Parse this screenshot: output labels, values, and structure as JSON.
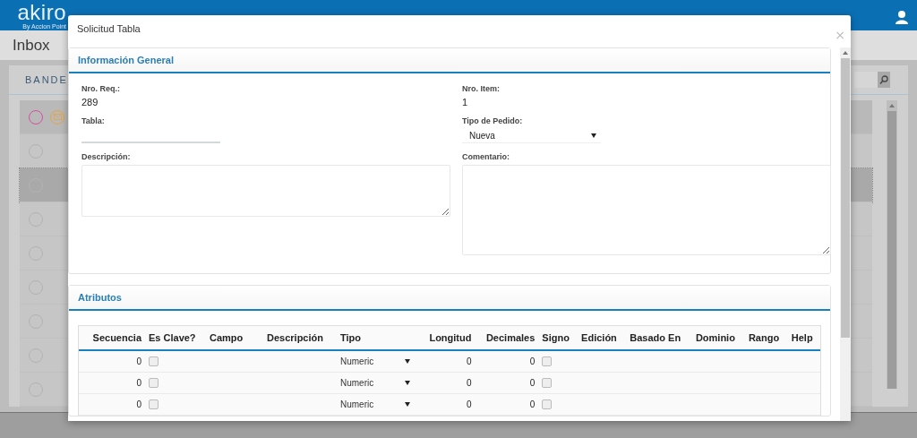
{
  "app_bar": {
    "logo": "akiro",
    "logo_tagline": "By Accion Point"
  },
  "page": {
    "title": "Inbox",
    "panel_title": "BANDE",
    "inbox_rows": [
      {
        "selected": false
      },
      {
        "selected": true
      },
      {
        "selected": false
      },
      {
        "selected": false
      },
      {
        "selected": false
      },
      {
        "selected": false
      },
      {
        "selected": false
      },
      {
        "selected": false
      }
    ]
  },
  "dialog": {
    "title": "Solicitud Tabla",
    "close": "×",
    "general": {
      "title": "Información General",
      "fields": [
        {
          "kind": "text",
          "label": "Nro. Req.:",
          "value": "289"
        },
        {
          "kind": "text",
          "label": "Nro. Item:",
          "value": "1"
        },
        {
          "kind": "input",
          "label": "Tabla:"
        },
        {
          "kind": "select",
          "label": "Tipo de Pedido:",
          "value": "Nueva"
        },
        {
          "kind": "textarea",
          "label": "Descripción:"
        },
        {
          "kind": "textarea",
          "label": "Comentario:"
        }
      ]
    },
    "attributes": {
      "title": "Atributos",
      "columns": [
        "Secuencia",
        "Es Clave?",
        "Campo",
        "Descripción",
        "Tipo",
        "Longitud",
        "Decimales",
        "Signo",
        "Edición",
        "Basado En",
        "Dominio",
        "Rango",
        "Help"
      ],
      "rows": [
        {
          "secuencia": "0",
          "es_clave": false,
          "tipo": "Numeric",
          "longitud": "0",
          "decimales": "0",
          "signo": false
        },
        {
          "secuencia": "0",
          "es_clave": false,
          "tipo": "Numeric",
          "longitud": "0",
          "decimales": "0",
          "signo": false
        },
        {
          "secuencia": "0",
          "es_clave": false,
          "tipo": "Numeric",
          "longitud": "0",
          "decimales": "0",
          "signo": false
        }
      ]
    }
  }
}
